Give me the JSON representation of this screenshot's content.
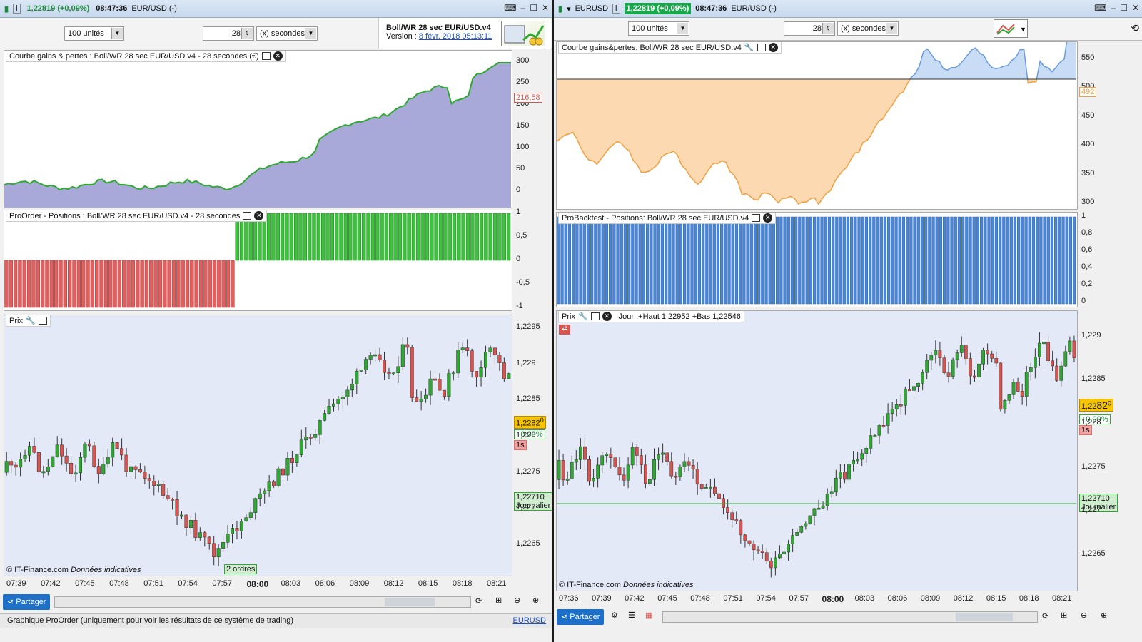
{
  "left": {
    "title": {
      "price": "1,22819 (+0,09%)",
      "time": "08:47:36",
      "symbol": "EUR/USD (-)"
    },
    "units": "100 unités",
    "period_value": "28",
    "period_unit": "(x) secondes",
    "strategy": {
      "name": "Boll/WR 28 sec EUR/USD.v4",
      "version_label": "Version :",
      "version_date": "8 févr. 2018 05:13:11"
    },
    "equity": {
      "title": "Courbe gains & pertes : Boll/WR 28 sec EUR/USD.v4 - 28 secondes (€)",
      "yticks": [
        "300",
        "250",
        "200",
        "150",
        "100",
        "50",
        "0"
      ],
      "value_tag": "216,58"
    },
    "positions": {
      "title": "ProOrder - Positions : Boll/WR 28 sec EUR/USD.v4 - 28 secondes",
      "yticks": [
        "1",
        "0,5",
        "0",
        "-0,5",
        "-1"
      ]
    },
    "price": {
      "title": "Prix",
      "yticks": [
        "1,2295",
        "1,229",
        "1,2285",
        "1,228",
        "1,2275",
        "1,227",
        "1,2265"
      ],
      "last_price_a": "1,2282",
      "last_price_b": "0",
      "change": "+0,09%",
      "interval": "1s",
      "daily_price": "1,22710",
      "daily_label": "Journalier",
      "orders_label": "2 ordres",
      "copyright": "© IT-Finance.com",
      "disclaimer": "Données indicatives"
    },
    "xticks": [
      "07:39",
      "07:42",
      "07:45",
      "07:48",
      "07:51",
      "07:54",
      "07:57",
      "08:00",
      "08:03",
      "08:06",
      "08:09",
      "08:12",
      "08:15",
      "08:18",
      "08:21"
    ],
    "share_label": "Partager",
    "status": "Graphique ProOrder (uniquement pour voir les résultats de ce système de trading)",
    "status_link": "EURUSD"
  },
  "right": {
    "title": {
      "symbol": "EURUSD",
      "price": "1,22819 (+0,09%)",
      "time": "08:47:36",
      "symbol_full": "EUR/USD (-)"
    },
    "units": "100 unités",
    "period_value": "28",
    "period_unit": "(x) secondes",
    "equity": {
      "title": "Courbe gains&pertes: Boll/WR 28 sec EUR/USD.v4",
      "yticks": [
        "550",
        "500",
        "450",
        "400",
        "350",
        "300"
      ],
      "value_tag": "492"
    },
    "positions": {
      "title": "ProBacktest - Positions: Boll/WR 28 sec EUR/USD.v4",
      "yticks": [
        "1",
        "0,8",
        "0,6",
        "0,4",
        "0,2",
        "0"
      ]
    },
    "price": {
      "title": "Prix",
      "day_info": "Jour :+Haut 1,22952 +Bas 1,22546",
      "yticks": [
        "1,229",
        "1,2285",
        "1,228",
        "1,2275",
        "1,227",
        "1,2265"
      ],
      "last_price_a": "1,22",
      "last_price_b": "82",
      "last_price_c": "0",
      "change": "+0,09%",
      "interval": "1s",
      "daily_price": "1,22710",
      "daily_label": "Journalier",
      "copyright": "© IT-Finance.com",
      "disclaimer": "Données indicatives"
    },
    "xticks": [
      "07:36",
      "07:39",
      "07:42",
      "07:45",
      "07:48",
      "07:51",
      "07:54",
      "07:57",
      "08:00",
      "08:03",
      "08:06",
      "08:09",
      "08:12",
      "08:15",
      "08:18",
      "08:21"
    ],
    "share_label": "Partager"
  },
  "colors": {
    "up": "#2fa832",
    "down": "#d9534f",
    "equity_fill": "#a9a9d9",
    "equity_line": "#2fa832",
    "pos_green": "#3cc23c",
    "pos_red": "#e06060",
    "pos_blue": "#4a86d8",
    "bt_orange": "#fcd9b0",
    "bt_blue": "#c9dcf5",
    "price_bg": "#e4e9f7",
    "daily_line": "#2fa832"
  }
}
